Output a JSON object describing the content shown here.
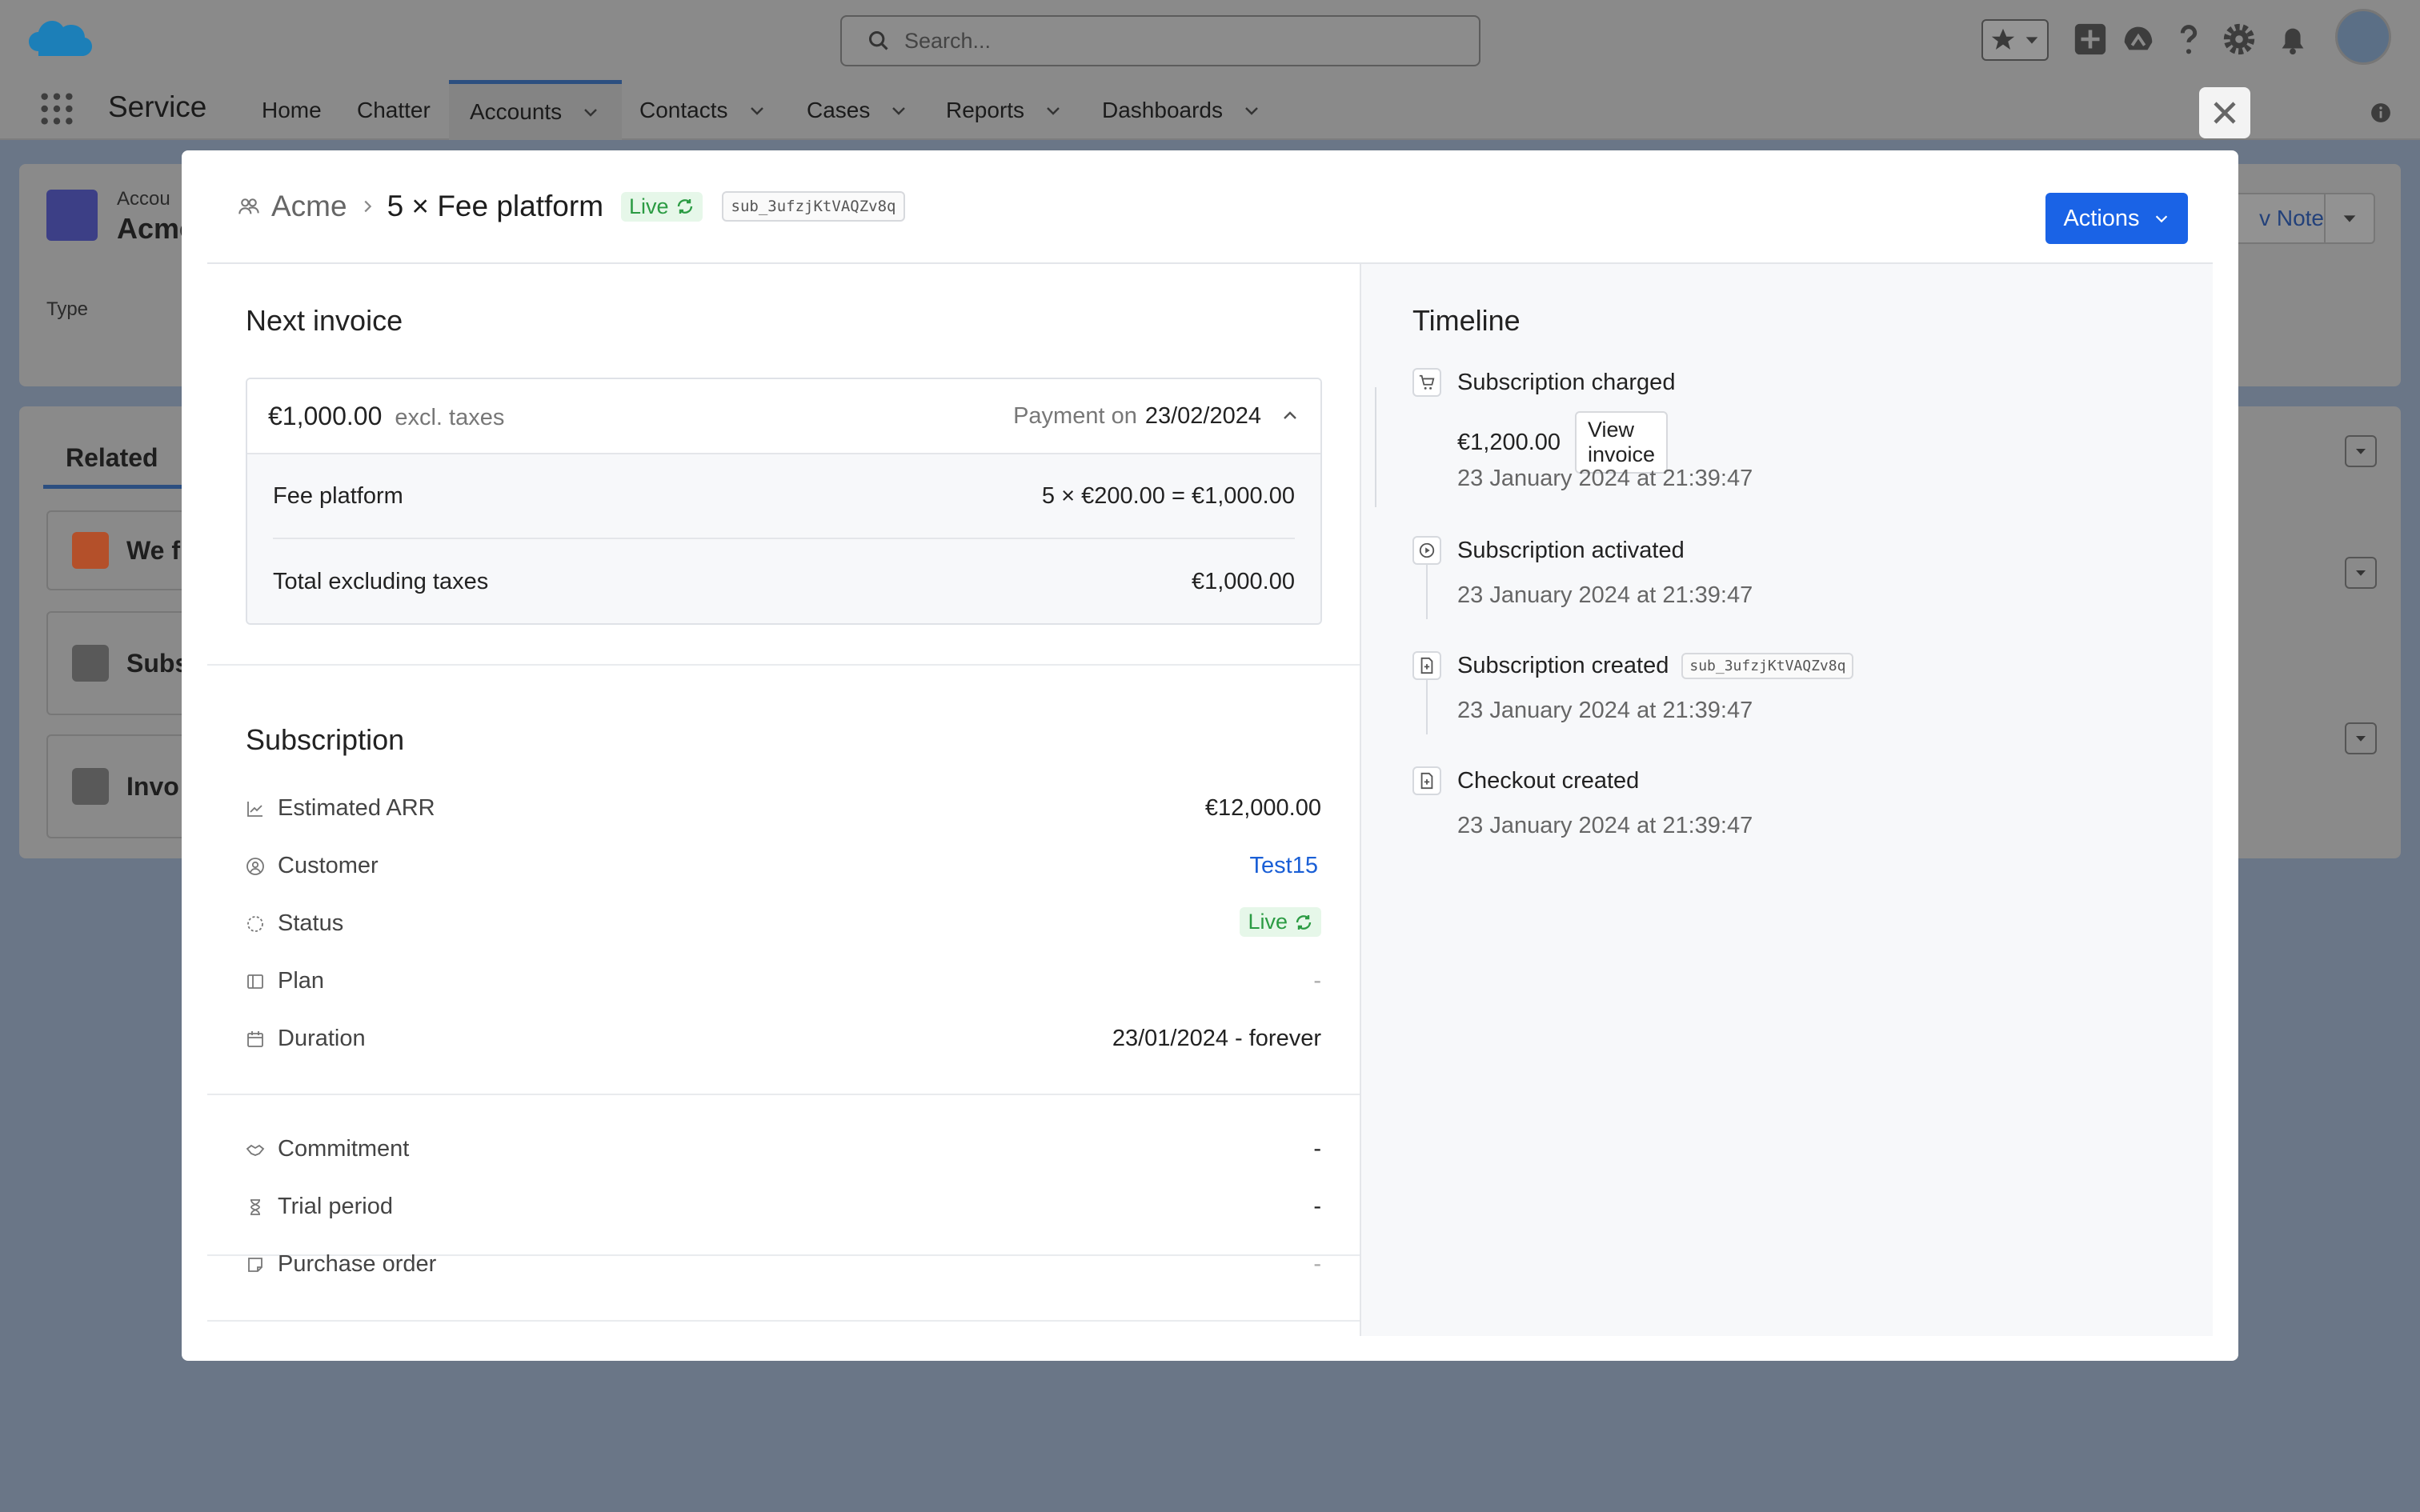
{
  "top": {
    "search_placeholder": "Search...",
    "app_name": "Service",
    "nav": [
      "Home",
      "Chatter",
      "Accounts",
      "Contacts",
      "Cases",
      "Reports",
      "Dashboards"
    ]
  },
  "background": {
    "record_object": "Accou",
    "record_name": "Acme",
    "type_label": "Type",
    "new_note_label": "v Note",
    "related_tab": "Related",
    "related_items": [
      "We f",
      "Subs",
      "Invo"
    ]
  },
  "modal": {
    "breadcrumb_account": "Acme",
    "breadcrumb_title": "5 × Fee platform",
    "status_badge": "Live",
    "subscription_id": "sub_3ufzjKtVAQZv8q",
    "actions_label": "Actions",
    "next_invoice": {
      "title": "Next invoice",
      "amount": "€1,000.00",
      "amount_suffix": "excl. taxes",
      "payment_prefix": "Payment on",
      "payment_date": "23/02/2024",
      "lines": [
        {
          "label": "Fee platform",
          "value": "5 × €200.00 = €1,000.00"
        },
        {
          "label": "Total excluding taxes",
          "value": "€1,000.00"
        }
      ]
    },
    "subscription": {
      "title": "Subscription",
      "rows": [
        {
          "icon": "chart-line-icon",
          "label": "Estimated ARR",
          "value": "€12,000.00"
        },
        {
          "icon": "user-circle-icon",
          "label": "Customer",
          "value": "Test15"
        },
        {
          "icon": "status-dashed-circle-icon",
          "label": "Status",
          "value": "Live"
        },
        {
          "icon": "plan-book-icon",
          "label": "Plan",
          "value": "-"
        },
        {
          "icon": "calendar-icon",
          "label": "Duration",
          "value": "23/01/2024 - forever"
        }
      ],
      "extra_rows": [
        {
          "icon": "handshake-icon",
          "label": "Commitment",
          "value": "-"
        },
        {
          "icon": "hourglass-icon",
          "label": "Trial period",
          "value": "-"
        },
        {
          "icon": "note-icon",
          "label": "Purchase order",
          "value": "-"
        }
      ]
    },
    "timeline": {
      "title": "Timeline",
      "items": [
        {
          "icon": "cart-icon",
          "title": "Subscription charged",
          "amount": "€1,200.00",
          "button": "View invoice",
          "date": "23 January 2024 at 21:39:47"
        },
        {
          "icon": "play-icon",
          "title": "Subscription activated",
          "date": "23 January 2024 at 21:39:47"
        },
        {
          "icon": "document-plus-icon",
          "title": "Subscription created",
          "chip": "sub_3ufzjKtVAQZv8q",
          "date": "23 January 2024 at 21:39:47"
        },
        {
          "icon": "document-plus-icon",
          "title": "Checkout created",
          "date": "23 January 2024 at 21:39:47"
        }
      ]
    }
  },
  "colors": {
    "accent": "#1a63e6",
    "live_green": "#2b9b43",
    "link_blue": "#1a5fd6"
  }
}
